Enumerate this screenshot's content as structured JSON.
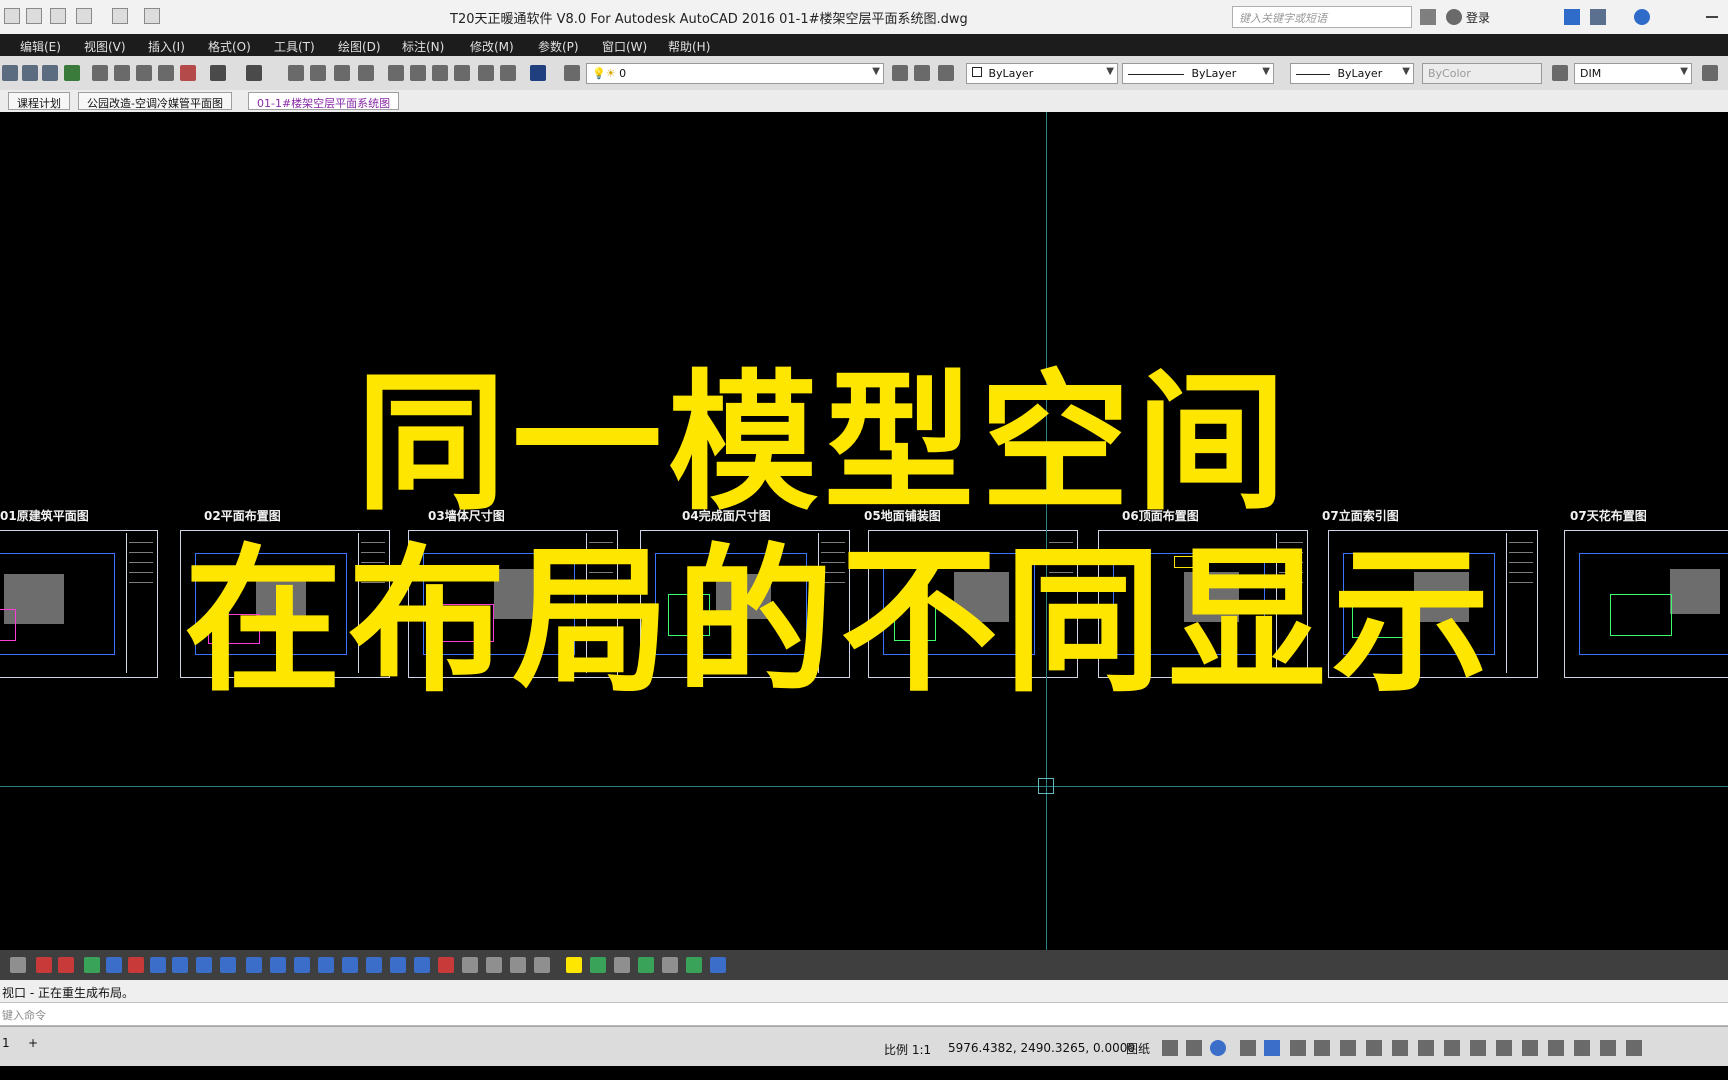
{
  "window": {
    "title": "T20天正暖通软件 V8.0 For Autodesk AutoCAD 2016    01-1#楼架空层平面系统图.dwg",
    "search_placeholder": "键入关键字或短语",
    "login_label": "登录"
  },
  "menu": [
    "编辑(E)",
    "视图(V)",
    "插入(I)",
    "格式(O)",
    "工具(T)",
    "绘图(D)",
    "标注(N)",
    "修改(M)",
    "参数(P)",
    "窗口(W)",
    "帮助(H)"
  ],
  "toolbar": {
    "layer_value": "0",
    "color_value": "ByLayer",
    "linetype_value": "ByLayer",
    "lineweight_value": "ByLayer",
    "plotstyle_value": "ByColor",
    "dimstyle_value": "DIM"
  },
  "tabs": [
    {
      "label": "课程计划"
    },
    {
      "label": "公园改造-空调冷媒管平面图"
    },
    {
      "label": "01-1#楼架空层平面系统图"
    }
  ],
  "sheets": [
    {
      "label": "01原建筑平面图"
    },
    {
      "label": "02平面布置图"
    },
    {
      "label": "03墙体尺寸图"
    },
    {
      "label": "04完成面尺寸图"
    },
    {
      "label": "05地面铺装图"
    },
    {
      "label": "06顶面布置图"
    },
    {
      "label": "07立面索引图"
    },
    {
      "label": "07天花布置图"
    }
  ],
  "overlay": {
    "line1": "同一模型空间",
    "line2": "在布局的不同显示",
    "color": "#ffe600"
  },
  "command": {
    "history": "视口 - 正在重生成布局。",
    "input_placeholder": "键入命令"
  },
  "status": {
    "layout_tab": "1",
    "add_tab": "+",
    "scale": "比例 1:1",
    "coordinates": "5976.4382, 2490.3265, 0.0000",
    "paper_label": "图纸"
  },
  "colors": {
    "crosshair": "#2d7f86",
    "sheet_border": "#cfd3e6",
    "plan_blue": "#3a73ff"
  }
}
